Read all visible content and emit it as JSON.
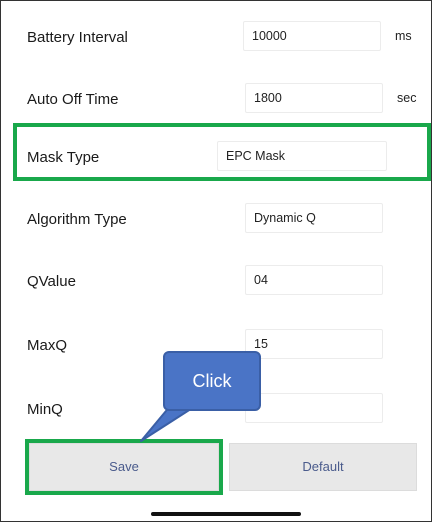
{
  "settings": {
    "battery_interval": {
      "label": "Battery Interval",
      "value": "10000",
      "unit": "ms"
    },
    "auto_off_time": {
      "label": "Auto Off Time",
      "value": "1800",
      "unit": "sec"
    },
    "mask_type": {
      "label": "Mask Type",
      "value": "EPC Mask"
    },
    "algorithm_type": {
      "label": "Algorithm Type",
      "value": "Dynamic Q"
    },
    "qvalue": {
      "label": "QValue",
      "value": "04"
    },
    "maxq": {
      "label": "MaxQ",
      "value": "15"
    },
    "minq": {
      "label": "MinQ",
      "value": ""
    }
  },
  "buttons": {
    "save_label": "Save",
    "default_label": "Default"
  },
  "annotation": {
    "callout_text": "Click",
    "highlight_color": "#19a84b",
    "callout_color": "#4a74c6"
  }
}
